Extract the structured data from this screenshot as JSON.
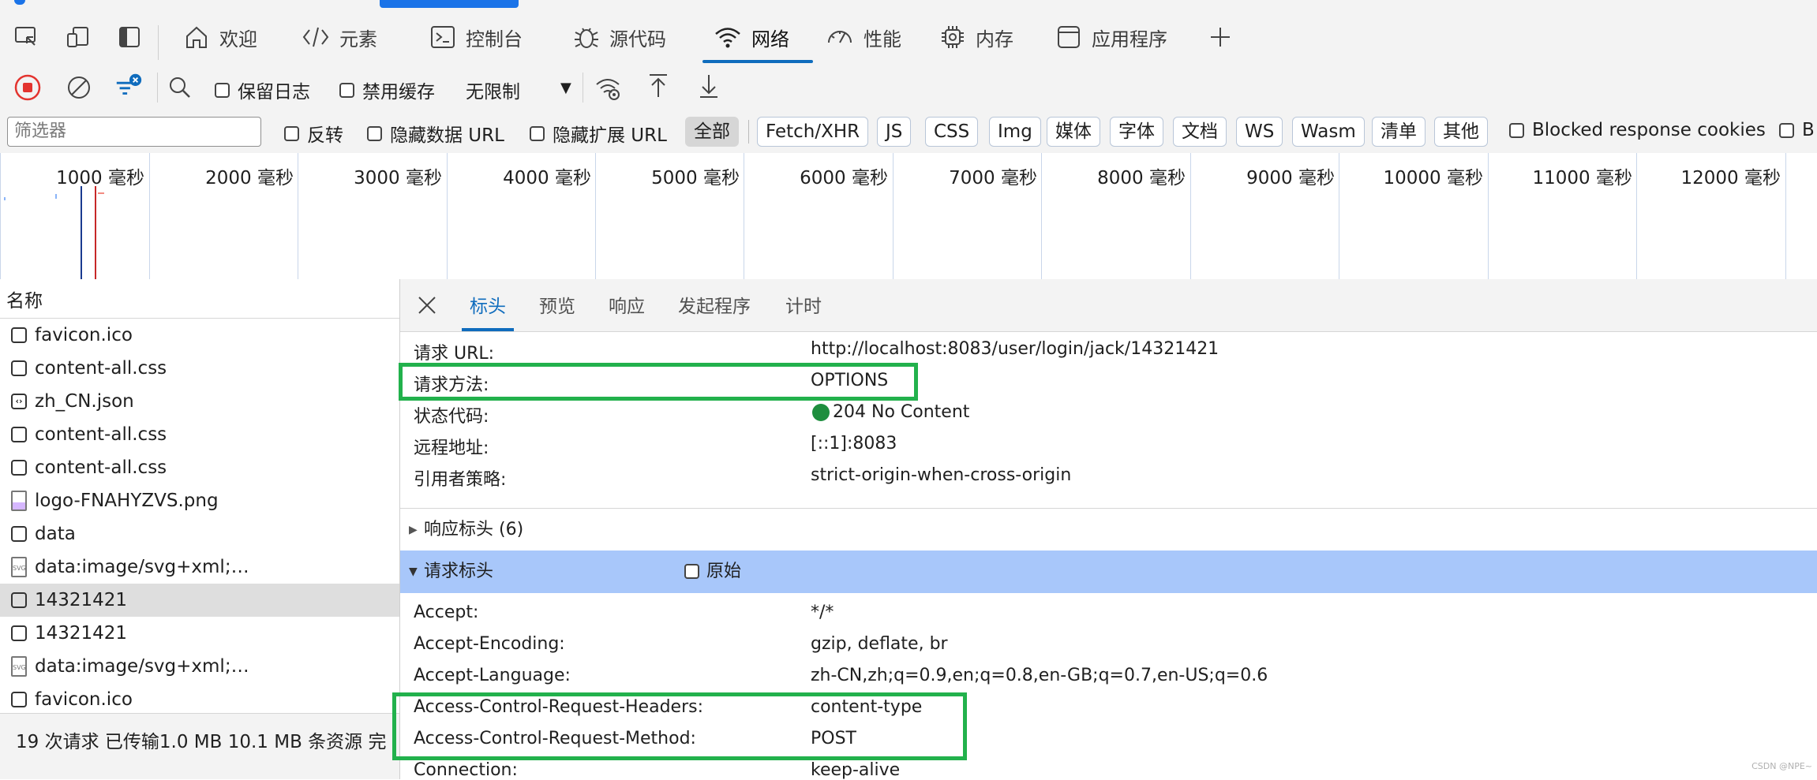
{
  "main_tabs": [
    {
      "label": "欢迎",
      "icon": "home-icon"
    },
    {
      "label": "元素",
      "icon": "code-icon"
    },
    {
      "label": "控制台",
      "icon": "console-icon"
    },
    {
      "label": "源代码",
      "icon": "bug-icon"
    },
    {
      "label": "网络",
      "icon": "wifi-icon",
      "active": true
    },
    {
      "label": "性能",
      "icon": "gauge-icon"
    },
    {
      "label": "内存",
      "icon": "chip-icon"
    },
    {
      "label": "应用程序",
      "icon": "app-window-icon"
    }
  ],
  "toolbar": {
    "preserve_log": "保留日志",
    "disable_cache": "禁用缓存",
    "throttle": "无限制"
  },
  "filter": {
    "placeholder": "筛选器",
    "invert": "反转",
    "hide_data_url": "隐藏数据 URL",
    "hide_ext_url": "隐藏扩展 URL",
    "types": [
      "全部",
      "Fetch/XHR",
      "JS",
      "CSS",
      "Img",
      "媒体",
      "字体",
      "文档",
      "WS",
      "Wasm",
      "清单",
      "其他"
    ],
    "blocked_cookies": "Blocked response cookies",
    "trailing": "B"
  },
  "timeline": {
    "ticks": [
      "1000 毫秒",
      "2000 毫秒",
      "3000 毫秒",
      "4000 毫秒",
      "5000 毫秒",
      "6000 毫秒",
      "7000 毫秒",
      "8000 毫秒",
      "9000 毫秒",
      "10000 毫秒",
      "11000 毫秒",
      "12000 毫秒"
    ]
  },
  "request_list": {
    "header": "名称",
    "items": [
      {
        "name": "favicon.ico",
        "type": "doc"
      },
      {
        "name": "content-all.css",
        "type": "doc"
      },
      {
        "name": "zh_CN.json",
        "type": "json"
      },
      {
        "name": "content-all.css",
        "type": "doc"
      },
      {
        "name": "content-all.css",
        "type": "doc"
      },
      {
        "name": "logo-FNAHYZVS.png",
        "type": "img"
      },
      {
        "name": "data",
        "type": "doc"
      },
      {
        "name": "data:image/svg+xml;…",
        "type": "svg"
      },
      {
        "name": "14321421",
        "type": "doc",
        "selected": true
      },
      {
        "name": "14321421",
        "type": "doc"
      },
      {
        "name": "data:image/svg+xml;…",
        "type": "svg"
      },
      {
        "name": "favicon.ico",
        "type": "doc"
      }
    ],
    "status": "19 次请求   已传输1.0 MB   10.1 MB 条资源   完"
  },
  "detail": {
    "tabs": [
      "标头",
      "预览",
      "响应",
      "发起程序",
      "计时"
    ],
    "general": [
      {
        "key": "请求 URL:",
        "value": "http://localhost:8083/user/login/jack/14321421"
      },
      {
        "key": "请求方法:",
        "value": "OPTIONS"
      },
      {
        "key": "状态代码:",
        "value": "204 No Content"
      },
      {
        "key": "远程地址:",
        "value": "[::1]:8083"
      },
      {
        "key": "引用者策略:",
        "value": "strict-origin-when-cross-origin"
      }
    ],
    "response_headers_label": "响应标头 (6)",
    "request_headers_label": "请求标头",
    "raw_label": "原始",
    "request_headers": [
      {
        "key": "Accept:",
        "value": "*/*"
      },
      {
        "key": "Accept-Encoding:",
        "value": "gzip, deflate, br"
      },
      {
        "key": "Accept-Language:",
        "value": "zh-CN,zh;q=0.9,en;q=0.8,en-GB;q=0.7,en-US;q=0.6"
      },
      {
        "key": "Access-Control-Request-Headers:",
        "value": "content-type"
      },
      {
        "key": "Access-Control-Request-Method:",
        "value": "POST"
      },
      {
        "key": "Connection:",
        "value": "keep-alive"
      }
    ]
  },
  "watermark": "CSDN @NPE~",
  "colors": {
    "accent": "#0f6cbd",
    "record": "#e3342f",
    "highlight": "#22b14c",
    "status_ok": "#1e8e3e",
    "section_bg": "#a8c7fa"
  }
}
